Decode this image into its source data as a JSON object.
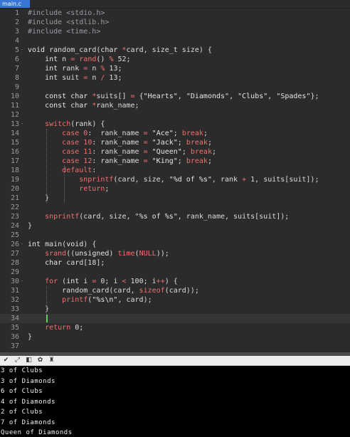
{
  "tab": {
    "filename": "main.c"
  },
  "editor": {
    "lines": [
      {
        "n": "1",
        "fold": "",
        "tokens": [
          [
            "pp",
            "#include <stdio.h>"
          ]
        ]
      },
      {
        "n": "2",
        "fold": "",
        "tokens": [
          [
            "pp",
            "#include <stdlib.h>"
          ]
        ]
      },
      {
        "n": "3",
        "fold": "",
        "tokens": [
          [
            "pp",
            "#include <time.h>"
          ]
        ]
      },
      {
        "n": "4",
        "fold": "",
        "tokens": []
      },
      {
        "n": "5",
        "fold": "-",
        "tokens": [
          [
            "kw",
            "void"
          ],
          [
            "txt",
            " random_card("
          ],
          [
            "kw",
            "char"
          ],
          [
            "txt",
            " "
          ],
          [
            "op",
            "*"
          ],
          [
            "txt",
            "card, size_t size) {"
          ]
        ]
      },
      {
        "n": "6",
        "fold": "",
        "tokens": [
          [
            "txt",
            "    "
          ],
          [
            "kw",
            "int"
          ],
          [
            "txt",
            " n "
          ],
          [
            "op",
            "="
          ],
          [
            "txt",
            " "
          ],
          [
            "fn",
            "rand"
          ],
          [
            "txt",
            "() "
          ],
          [
            "op",
            "%"
          ],
          [
            "txt",
            " 52;"
          ]
        ]
      },
      {
        "n": "7",
        "fold": "",
        "tokens": [
          [
            "txt",
            "    "
          ],
          [
            "kw",
            "int"
          ],
          [
            "txt",
            " rank "
          ],
          [
            "op",
            "="
          ],
          [
            "txt",
            " n "
          ],
          [
            "op",
            "%"
          ],
          [
            "txt",
            " 13;"
          ]
        ]
      },
      {
        "n": "8",
        "fold": "",
        "tokens": [
          [
            "txt",
            "    "
          ],
          [
            "kw",
            "int"
          ],
          [
            "txt",
            " suit "
          ],
          [
            "op",
            "="
          ],
          [
            "txt",
            " n "
          ],
          [
            "op",
            "/"
          ],
          [
            "txt",
            " 13;"
          ]
        ]
      },
      {
        "n": "9",
        "fold": "",
        "tokens": []
      },
      {
        "n": "10",
        "fold": "",
        "tokens": [
          [
            "txt",
            "    "
          ],
          [
            "kw",
            "const char"
          ],
          [
            "txt",
            " "
          ],
          [
            "op",
            "*"
          ],
          [
            "txt",
            "suits[] "
          ],
          [
            "op",
            "="
          ],
          [
            "txt",
            " {"
          ],
          [
            "str",
            "\"Hearts\""
          ],
          [
            "txt",
            ", "
          ],
          [
            "str",
            "\"Diamonds\""
          ],
          [
            "txt",
            ", "
          ],
          [
            "str",
            "\"Clubs\""
          ],
          [
            "txt",
            ", "
          ],
          [
            "str",
            "\"Spades\""
          ],
          [
            "txt",
            "};"
          ]
        ]
      },
      {
        "n": "11",
        "fold": "",
        "tokens": [
          [
            "txt",
            "    "
          ],
          [
            "kw",
            "const char"
          ],
          [
            "txt",
            " "
          ],
          [
            "op",
            "*"
          ],
          [
            "txt",
            "rank_name;"
          ]
        ]
      },
      {
        "n": "12",
        "fold": "",
        "tokens": []
      },
      {
        "n": "13",
        "fold": "-",
        "tokens": [
          [
            "txt",
            "    "
          ],
          [
            "ctl",
            "switch"
          ],
          [
            "txt",
            "(rank) {"
          ]
        ]
      },
      {
        "n": "14",
        "fold": "",
        "tokens": [
          [
            "txt",
            "        "
          ],
          [
            "ctl",
            "case"
          ],
          [
            "txt",
            " "
          ],
          [
            "ctl",
            "0"
          ],
          [
            "txt",
            ":  rank_name "
          ],
          [
            "op",
            "="
          ],
          [
            "txt",
            " "
          ],
          [
            "str",
            "\"Ace\""
          ],
          [
            "txt",
            "; "
          ],
          [
            "ctl",
            "break"
          ],
          [
            "txt",
            ";"
          ]
        ]
      },
      {
        "n": "15",
        "fold": "",
        "tokens": [
          [
            "txt",
            "        "
          ],
          [
            "ctl",
            "case"
          ],
          [
            "txt",
            " "
          ],
          [
            "ctl",
            "10"
          ],
          [
            "txt",
            ": rank_name "
          ],
          [
            "op",
            "="
          ],
          [
            "txt",
            " "
          ],
          [
            "str",
            "\"Jack\""
          ],
          [
            "txt",
            "; "
          ],
          [
            "ctl",
            "break"
          ],
          [
            "txt",
            ";"
          ]
        ]
      },
      {
        "n": "16",
        "fold": "",
        "tokens": [
          [
            "txt",
            "        "
          ],
          [
            "ctl",
            "case"
          ],
          [
            "txt",
            " "
          ],
          [
            "ctl",
            "11"
          ],
          [
            "txt",
            ": rank_name "
          ],
          [
            "op",
            "="
          ],
          [
            "txt",
            " "
          ],
          [
            "str",
            "\"Queen\""
          ],
          [
            "txt",
            "; "
          ],
          [
            "ctl",
            "break"
          ],
          [
            "txt",
            ";"
          ]
        ]
      },
      {
        "n": "17",
        "fold": "",
        "tokens": [
          [
            "txt",
            "        "
          ],
          [
            "ctl",
            "case"
          ],
          [
            "txt",
            " "
          ],
          [
            "ctl",
            "12"
          ],
          [
            "txt",
            ": rank_name "
          ],
          [
            "op",
            "="
          ],
          [
            "txt",
            " "
          ],
          [
            "str",
            "\"King\""
          ],
          [
            "txt",
            "; "
          ],
          [
            "ctl",
            "break"
          ],
          [
            "txt",
            ";"
          ]
        ]
      },
      {
        "n": "18",
        "fold": "",
        "tokens": [
          [
            "txt",
            "        "
          ],
          [
            "ctl",
            "default"
          ],
          [
            "txt",
            ":"
          ]
        ]
      },
      {
        "n": "19",
        "fold": "",
        "tokens": [
          [
            "txt",
            "            "
          ],
          [
            "fn",
            "snprintf"
          ],
          [
            "txt",
            "(card, size, "
          ],
          [
            "str",
            "\"%d of %s\""
          ],
          [
            "txt",
            ", rank "
          ],
          [
            "op",
            "+"
          ],
          [
            "txt",
            " 1, suits[suit]);"
          ]
        ]
      },
      {
        "n": "20",
        "fold": "",
        "tokens": [
          [
            "txt",
            "            "
          ],
          [
            "ctl",
            "return"
          ],
          [
            "txt",
            ";"
          ]
        ]
      },
      {
        "n": "21",
        "fold": "",
        "tokens": [
          [
            "txt",
            "    }"
          ]
        ]
      },
      {
        "n": "22",
        "fold": "",
        "tokens": []
      },
      {
        "n": "23",
        "fold": "",
        "tokens": [
          [
            "txt",
            "    "
          ],
          [
            "fn",
            "snprintf"
          ],
          [
            "txt",
            "(card, size, "
          ],
          [
            "str",
            "\"%s of %s\""
          ],
          [
            "txt",
            ", rank_name, suits[suit]);"
          ]
        ]
      },
      {
        "n": "24",
        "fold": "",
        "tokens": [
          [
            "txt",
            "}"
          ]
        ]
      },
      {
        "n": "25",
        "fold": "",
        "tokens": []
      },
      {
        "n": "26",
        "fold": "-",
        "tokens": [
          [
            "kw",
            "int"
          ],
          [
            "txt",
            " main("
          ],
          [
            "kw",
            "void"
          ],
          [
            "txt",
            ") {"
          ]
        ]
      },
      {
        "n": "27",
        "fold": "",
        "tokens": [
          [
            "txt",
            "    "
          ],
          [
            "fn",
            "srand"
          ],
          [
            "txt",
            "(("
          ],
          [
            "kw",
            "unsigned"
          ],
          [
            "txt",
            ") "
          ],
          [
            "fn",
            "time"
          ],
          [
            "txt",
            "("
          ],
          [
            "ctl",
            "NULL"
          ],
          [
            "txt",
            "));"
          ]
        ]
      },
      {
        "n": "28",
        "fold": "",
        "tokens": [
          [
            "txt",
            "    "
          ],
          [
            "kw",
            "char"
          ],
          [
            "txt",
            " card[18];"
          ]
        ]
      },
      {
        "n": "29",
        "fold": "",
        "tokens": []
      },
      {
        "n": "30",
        "fold": "-",
        "tokens": [
          [
            "txt",
            "    "
          ],
          [
            "ctl",
            "for"
          ],
          [
            "txt",
            " ("
          ],
          [
            "kw",
            "int"
          ],
          [
            "txt",
            " i "
          ],
          [
            "op",
            "="
          ],
          [
            "txt",
            " 0; i "
          ],
          [
            "op",
            "<"
          ],
          [
            "txt",
            " 100; i"
          ],
          [
            "op",
            "++"
          ],
          [
            "txt",
            ") {"
          ]
        ]
      },
      {
        "n": "31",
        "fold": "",
        "tokens": [
          [
            "txt",
            "        random_card(card, "
          ],
          [
            "fn",
            "sizeof"
          ],
          [
            "txt",
            "(card));"
          ]
        ]
      },
      {
        "n": "32",
        "fold": "",
        "tokens": [
          [
            "txt",
            "        "
          ],
          [
            "fn",
            "printf"
          ],
          [
            "txt",
            "("
          ],
          [
            "str",
            "\"%s\\n\""
          ],
          [
            "txt",
            ", card);"
          ]
        ]
      },
      {
        "n": "33",
        "fold": "",
        "tokens": [
          [
            "txt",
            "    }"
          ]
        ]
      },
      {
        "n": "34",
        "fold": "",
        "tokens": [],
        "current": true
      },
      {
        "n": "35",
        "fold": "",
        "tokens": [
          [
            "txt",
            "    "
          ],
          [
            "ctl",
            "return"
          ],
          [
            "txt",
            " 0;"
          ]
        ]
      },
      {
        "n": "36",
        "fold": "",
        "tokens": [
          [
            "txt",
            "}"
          ]
        ]
      },
      {
        "n": "37",
        "fold": "",
        "tokens": []
      }
    ]
  },
  "toolbar": {
    "icons": [
      "chevron-down-icon",
      "expand-icon",
      "layout-icon",
      "gear-icon",
      "clear-icon"
    ],
    "glyphs": [
      "✔",
      "⤢",
      "◧",
      "✿",
      "♜"
    ]
  },
  "terminal": {
    "output": [
      "3 of Clubs",
      "3 of Diamonds",
      "6 of Clubs",
      "4 of Diamonds",
      "2 of Clubs",
      "7 of Diamonds",
      "Queen of Diamonds"
    ]
  },
  "colors": {
    "tab_active": "#3875d7",
    "keyword_red": "#f06f6f",
    "editor_bg": "#2b2b2b",
    "terminal_bg": "#000000",
    "cursor": "#5ad15a"
  }
}
